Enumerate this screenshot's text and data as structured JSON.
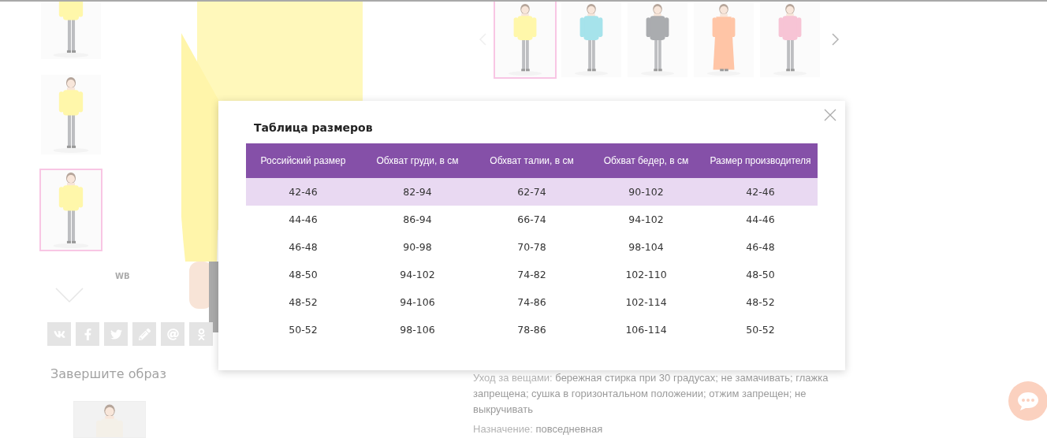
{
  "gallery": {
    "thumbnails": [
      {
        "kind": "picture",
        "selected": false
      },
      {
        "kind": "picture",
        "selected": false
      },
      {
        "kind": "picture",
        "selected": true
      }
    ]
  },
  "brand_mark": "WB",
  "complete_look": {
    "title": "Завершите образ"
  },
  "color_carousel": {
    "items": [
      {
        "kind": "picture",
        "selected": true
      },
      {
        "kind": "picture",
        "selected": false
      },
      {
        "kind": "picture",
        "selected": false
      },
      {
        "kind": "picture",
        "selected": false
      },
      {
        "kind": "picture",
        "selected": false
      }
    ]
  },
  "details": [
    {
      "label": "Уход за вещами:",
      "value": "бережная стирка при 30 градусах; не замачивать; глажка запрещена; сушка в горизонтальном положении; отжим запрещен; не выкручивать"
    },
    {
      "label": "Назначение:",
      "value": "повседневная"
    }
  ],
  "size_chart": {
    "title": "Таблица размеров",
    "columns": [
      "Российский размер",
      "Обхват груди, в см",
      "Обхват талии, в см",
      "Обхват бедер, в см",
      "Размер производителя"
    ],
    "rows": [
      {
        "selected": true,
        "cells": [
          "42-46",
          "82-94",
          "62-74",
          "90-102",
          "42-46"
        ]
      },
      {
        "selected": false,
        "cells": [
          "44-46",
          "86-94",
          "66-74",
          "94-102",
          "44-46"
        ]
      },
      {
        "selected": false,
        "cells": [
          "46-48",
          "90-98",
          "70-78",
          "98-104",
          "46-48"
        ]
      },
      {
        "selected": false,
        "cells": [
          "48-50",
          "94-102",
          "74-82",
          "102-110",
          "48-50"
        ]
      },
      {
        "selected": false,
        "cells": [
          "48-52",
          "94-106",
          "74-86",
          "102-114",
          "48-52"
        ]
      },
      {
        "selected": false,
        "cells": [
          "50-52",
          "98-106",
          "78-86",
          "106-114",
          "50-52"
        ]
      }
    ]
  }
}
